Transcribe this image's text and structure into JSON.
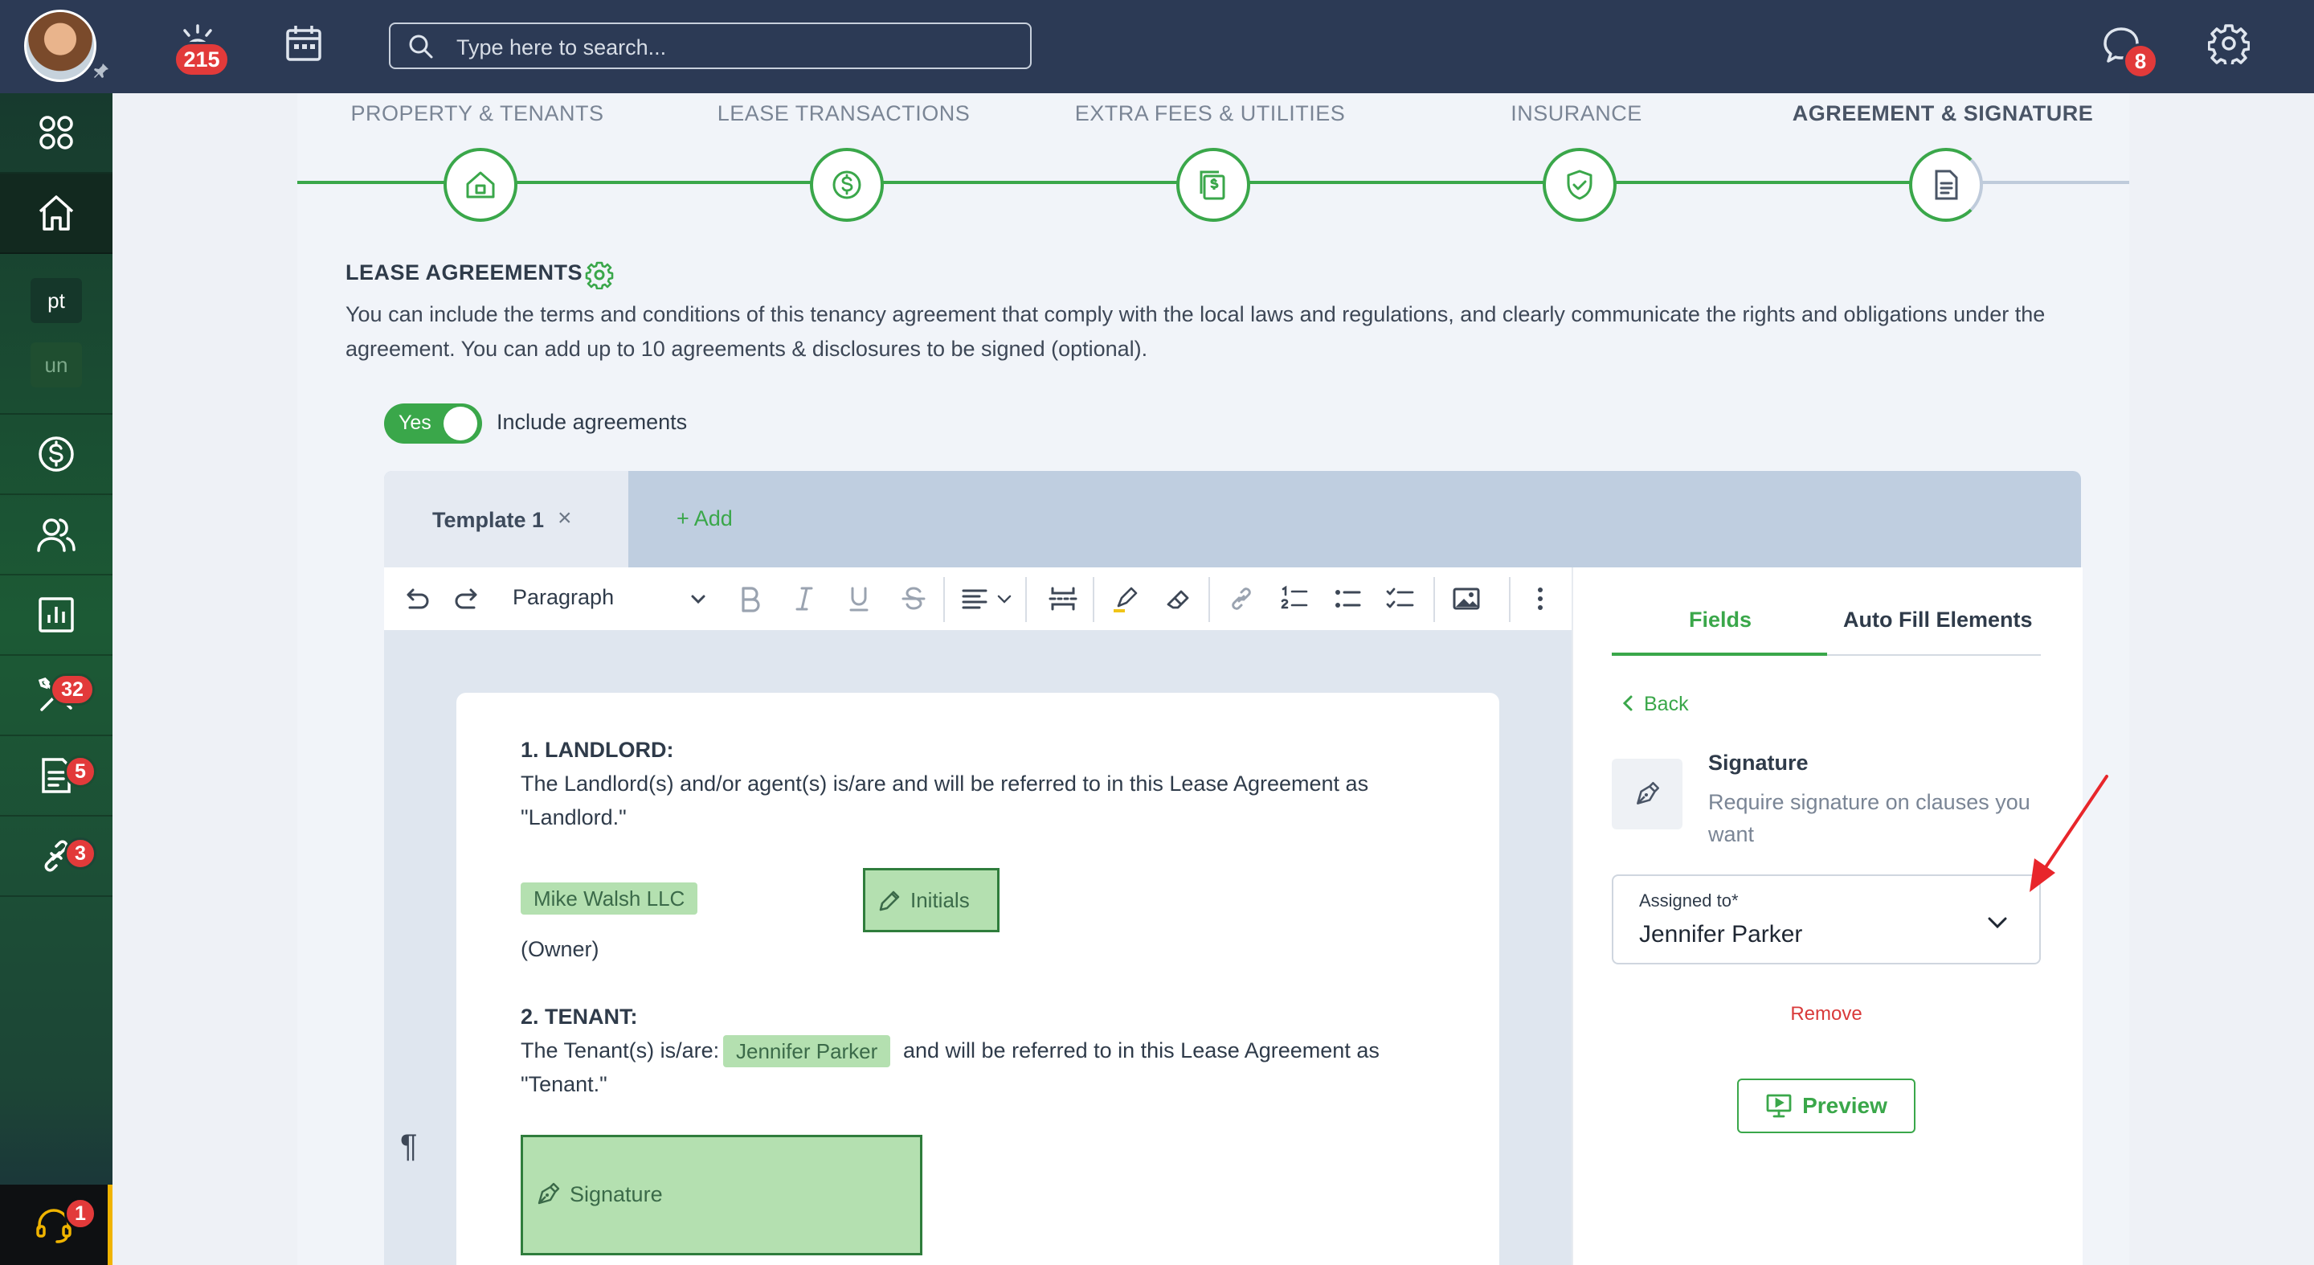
{
  "topbar": {
    "notifications_count": "215",
    "search_placeholder": "Type here to search...",
    "messages_count": "8"
  },
  "sidebar": {
    "text_items": [
      "pt",
      "un"
    ],
    "badges": {
      "maintenance": "32",
      "documents": "5",
      "links": "3",
      "support": "1"
    }
  },
  "steps": [
    {
      "label": "PROPERTY & TENANTS",
      "icon": "house-icon"
    },
    {
      "label": "LEASE TRANSACTIONS",
      "icon": "dollar-icon"
    },
    {
      "label": "EXTRA FEES & UTILITIES",
      "icon": "bills-icon"
    },
    {
      "label": "INSURANCE",
      "icon": "shield-check-icon"
    },
    {
      "label": "AGREEMENT & SIGNATURE",
      "icon": "document-icon"
    }
  ],
  "section": {
    "title": "LEASE AGREEMENTS",
    "description": "You can include the terms and conditions of this tenancy agreement that comply with the local laws and regulations, and clearly communicate the rights and obligations under the agreement. You can add up to 10 agreements & disclosures to be signed (optional)."
  },
  "toggle": {
    "state_label": "Yes",
    "label": "Include agreements",
    "on": true
  },
  "tabs": {
    "template_label": "Template 1",
    "close": "×",
    "add_label": "+ Add"
  },
  "toolbar": {
    "block_style": "Paragraph"
  },
  "document": {
    "landlord_heading": "1. LANDLORD:",
    "landlord_text": "The Landlord(s) and/or agent(s) is/are and will be referred to in this Lease Agreement as \"Landlord.\"",
    "landlord_chip": "Mike Walsh LLC",
    "initials_label": "Initials",
    "owner_text": "(Owner)",
    "tenant_heading": "2. TENANT:",
    "tenant_text_before": "The Tenant(s) is/are:",
    "tenant_chip": "Jennifer Parker",
    "tenant_text_after": "and will be referred to in this Lease Agreement as",
    "tenant_text_line2": "\"Tenant.\"",
    "signature_label": "Signature",
    "pilcrow": "¶"
  },
  "panel": {
    "tabs": [
      "Fields",
      "Auto Fill Elements"
    ],
    "active_tab": "Fields",
    "back_label": "Back",
    "field_title": "Signature",
    "field_desc": "Require signature on clauses you want",
    "assigned_label": "Assigned to*",
    "assigned_value": "Jennifer Parker",
    "remove_label": "Remove",
    "preview_label": "Preview"
  },
  "colors": {
    "accent_green": "#3aa74a",
    "topbar": "#2c3a55",
    "badge_red": "#e23a3a",
    "remove_red": "#d93a3a",
    "annotation_arrow": "#e8262b"
  }
}
